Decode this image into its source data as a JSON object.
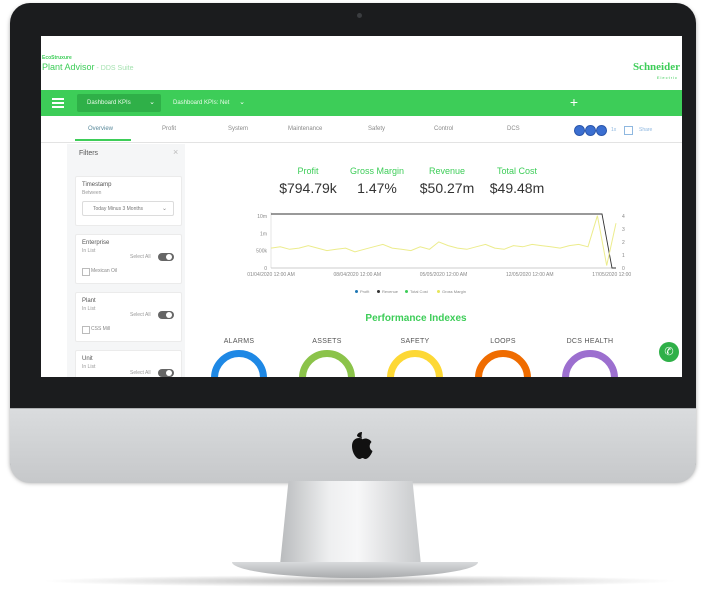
{
  "app": {
    "brand_small": "EcoStruxure",
    "title": "Plant Advisor",
    "subtitle": "- DDS Suite",
    "logo": "Schneider",
    "logo_sub": "Electric"
  },
  "toolbar": {
    "menu_icon": "hamburger-icon",
    "dashboard_select": "Dashboard KPIs",
    "second_select": "Dashboard KPIs: Net",
    "add_label": "+"
  },
  "tabs": [
    {
      "label": "Overview",
      "active": true
    },
    {
      "label": "Profit",
      "active": false
    },
    {
      "label": "System",
      "active": false
    },
    {
      "label": "Maintenance",
      "active": false
    },
    {
      "label": "Safety",
      "active": false
    },
    {
      "label": "Control",
      "active": false
    },
    {
      "label": "DCS",
      "active": false
    }
  ],
  "utility": {
    "buttons": [
      "user-icon",
      "settings-icon",
      "share-icon"
    ],
    "zoom_label": "1x",
    "share_label": "Share"
  },
  "filters": {
    "title": "Filters",
    "close_icon": "close-icon",
    "timestamp": {
      "label": "Timestamp",
      "sublabel": "Between",
      "value": "Today Minus 3 Months"
    },
    "enterprise": {
      "label": "Enterprise",
      "sublabel": "In List",
      "select_all": "Select All",
      "option": "Mexican Oil"
    },
    "plant": {
      "label": "Plant",
      "sublabel": "In List",
      "select_all": "Select All",
      "option": "CSS Mill"
    },
    "unit": {
      "label": "Unit",
      "sublabel": "In List",
      "select_all": "Select All"
    }
  },
  "kpis": [
    {
      "label": "Profit",
      "value": "$794.79k"
    },
    {
      "label": "Gross Margin",
      "value": "1.47%"
    },
    {
      "label": "Revenue",
      "value": "$50.27m"
    },
    {
      "label": "Total Cost",
      "value": "$49.48m"
    }
  ],
  "chart_data": {
    "type": "line",
    "x_ticks": [
      "01/04/2020 12:00 AM",
      "08/04/2020 12:00 AM",
      "05/05/2020 12:00 AM",
      "12/05/2020 12:00 AM",
      "17/05/2020 12:00 AM"
    ],
    "y_left_ticks": [
      "10m",
      "1m",
      "500k",
      "0"
    ],
    "y_right_ticks": [
      "4",
      "3",
      "2",
      "1",
      "0"
    ],
    "series": [
      {
        "name": "Profit",
        "color": "#1f77b4"
      },
      {
        "name": "Revenue",
        "color": "#333333"
      },
      {
        "name": "Total Cost",
        "color": "#3dcd58"
      },
      {
        "name": "Gross Margin",
        "color": "#e6e65a"
      }
    ],
    "gross_margin_values": [
      1.6,
      1.7,
      1.5,
      1.6,
      1.8,
      1.6,
      1.4,
      1.5,
      1.6,
      1.3,
      1.5,
      1.7,
      1.9,
      1.6,
      1.5,
      1.4,
      1.7,
      1.5,
      2.1,
      1.8,
      1.6,
      1.5,
      1.7,
      1.9,
      1.6,
      1.5,
      1.8,
      1.7,
      1.9,
      1.8,
      1.7,
      1.6,
      1.8,
      1.9,
      1.7,
      4.2,
      0.2,
      3.6
    ],
    "revenue_trend": "flat high then drops to zero at end",
    "y_right_lim": [
      0,
      4.5
    ]
  },
  "performance": {
    "title": "Performance Indexes",
    "gauges": [
      {
        "label": "ALARMS",
        "color": "#1e88e5"
      },
      {
        "label": "ASSETS",
        "color": "#8bc34a"
      },
      {
        "label": "SAFETY",
        "color": "#fdd835"
      },
      {
        "label": "LOOPS",
        "color": "#ef6c00"
      },
      {
        "label": "DCS HEALTH",
        "color": "#9c6fcf"
      }
    ]
  },
  "help_icon": "phone-icon"
}
